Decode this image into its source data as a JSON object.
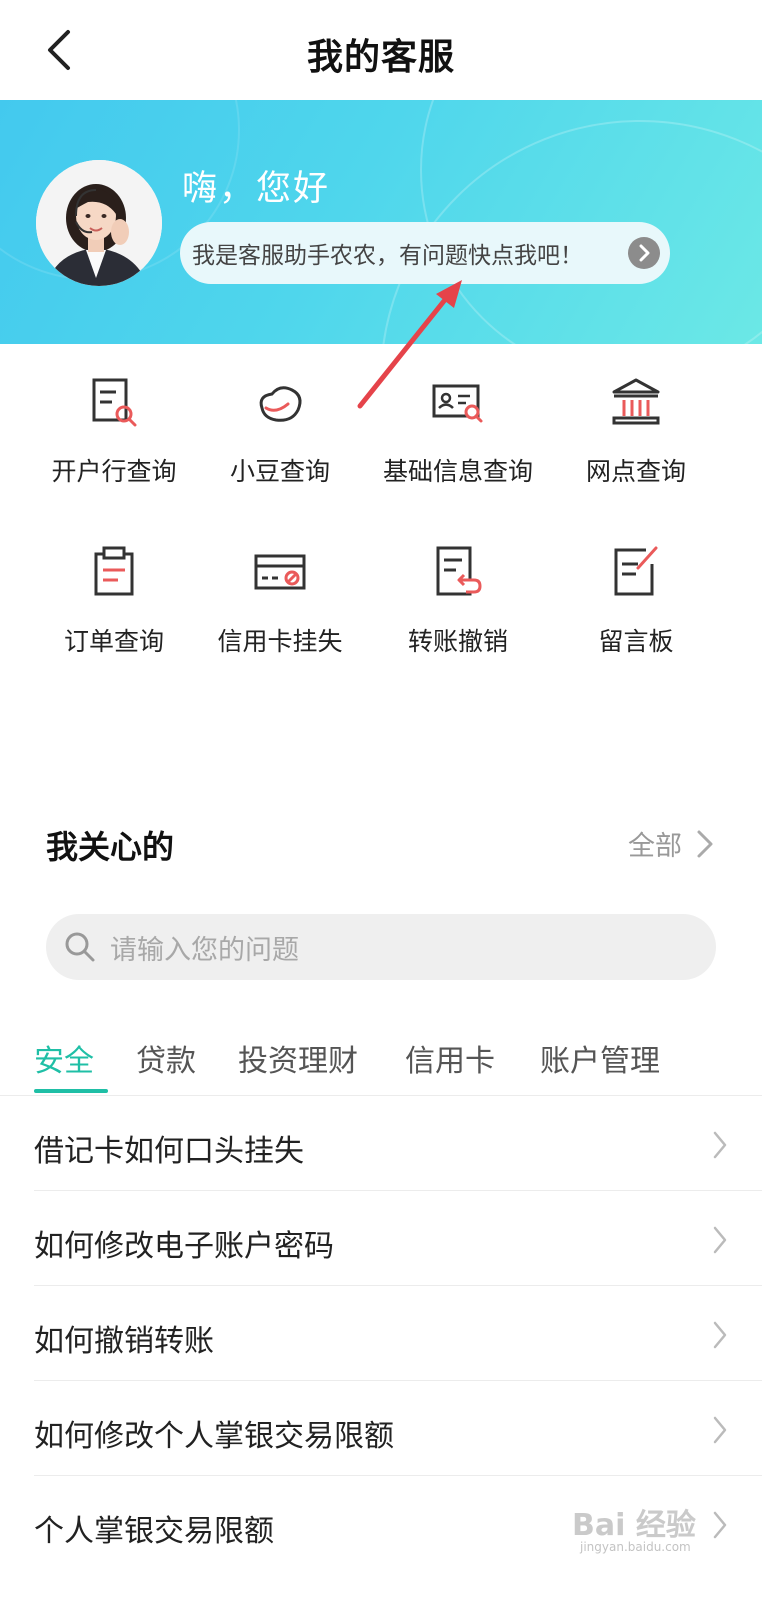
{
  "nav": {
    "title": "我的客服"
  },
  "banner": {
    "greeting": "嗨，您好",
    "bubble_text": "我是客服助手农农，有问题快点我吧！"
  },
  "services": [
    {
      "label": "开户行查询",
      "icon": "doc-search-icon"
    },
    {
      "label": "小豆查询",
      "icon": "bean-icon"
    },
    {
      "label": "基础信息查询",
      "icon": "id-card-search-icon"
    },
    {
      "label": "网点查询",
      "icon": "bank-building-icon"
    },
    {
      "label": "订单查询",
      "icon": "clipboard-icon"
    },
    {
      "label": "信用卡挂失",
      "icon": "card-block-icon"
    },
    {
      "label": "转账撤销",
      "icon": "doc-undo-icon"
    },
    {
      "label": "留言板",
      "icon": "note-edit-icon"
    }
  ],
  "section": {
    "title": "我关心的",
    "all_label": "全部"
  },
  "search": {
    "placeholder": "请输入您的问题"
  },
  "tabs": [
    "安全",
    "贷款",
    "投资理财",
    "信用卡",
    "账户管理"
  ],
  "active_tab": "安全",
  "faq": [
    "借记卡如何口头挂失",
    "如何修改电子账户密码",
    "如何撤销转账",
    "如何修改个人掌银交易限额",
    "个人掌银交易限额"
  ],
  "watermark": {
    "logo": "Bai 经验",
    "url": "jingyan.baidu.com"
  },
  "colors": {
    "accent": "#1fbfa6",
    "banner": "#4fd6ec",
    "annotation_arrow": "#e5434a"
  }
}
